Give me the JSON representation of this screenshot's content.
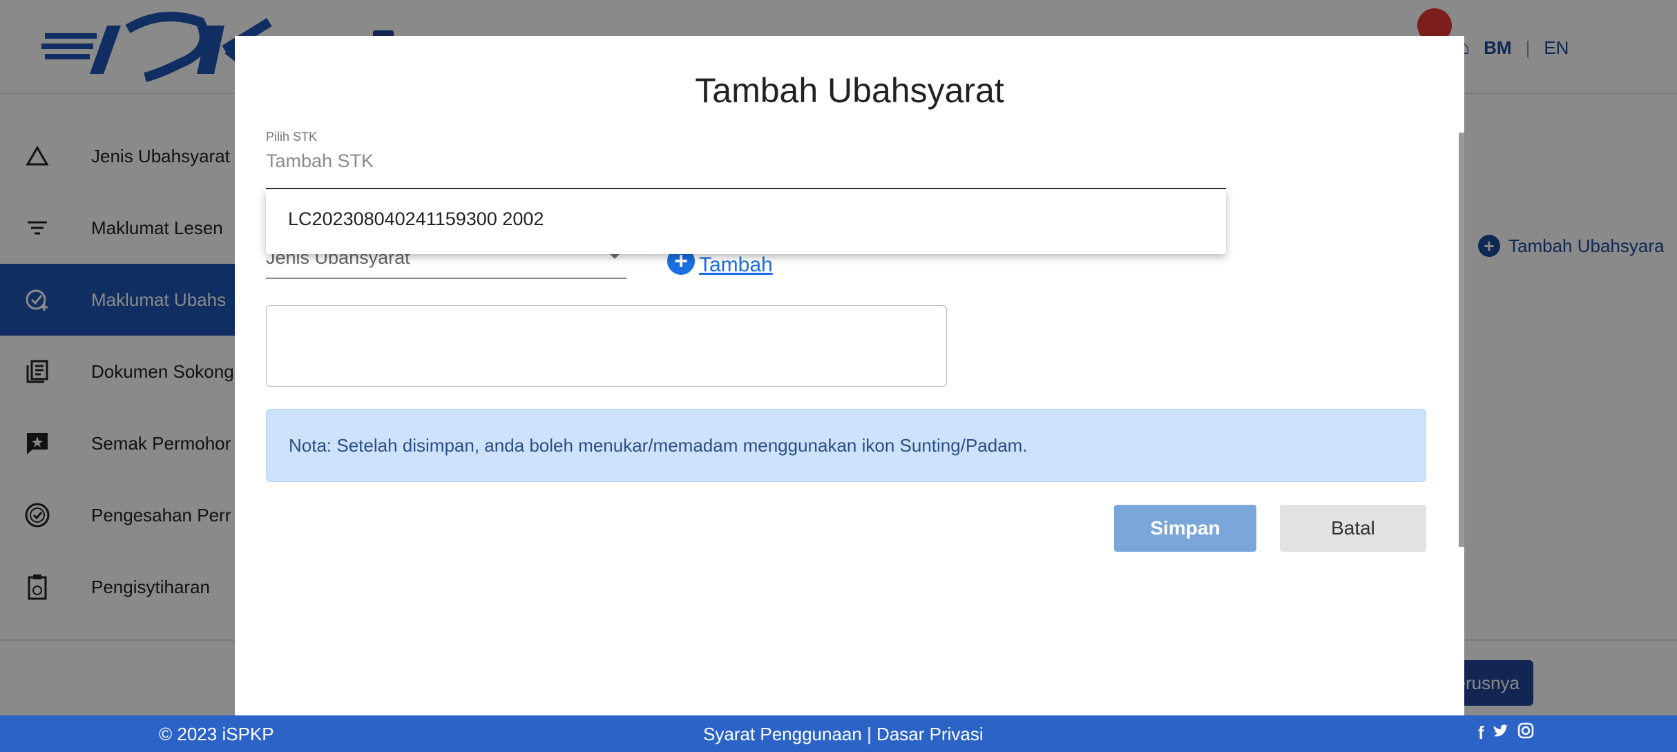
{
  "header": {
    "lang_bm": "BM",
    "lang_sep": "|",
    "lang_en": "EN"
  },
  "sidebar": {
    "items": [
      {
        "label": "Jenis Ubahsyarat",
        "icon": "triangle-icon"
      },
      {
        "label": "Maklumat Lesen",
        "icon": "filter-lines-icon"
      },
      {
        "label": "Maklumat Ubahs",
        "icon": "check-plus-icon",
        "active": true
      },
      {
        "label": "Dokumen Sokong",
        "icon": "document-list-icon"
      },
      {
        "label": "Semak Permohor",
        "icon": "chat-star-icon"
      },
      {
        "label": "Pengesahan Perr",
        "icon": "verified-badge-icon"
      },
      {
        "label": "Pengisytiharan",
        "icon": "clipboard-icon"
      }
    ]
  },
  "background": {
    "add_condition": "Tambah Ubahsyara",
    "next_button": "erusnya"
  },
  "modal": {
    "title": "Tambah Ubahsyarat",
    "stk": {
      "label": "Pilih STK",
      "placeholder": "Tambah STK",
      "option": "LC202308040241159300 2002"
    },
    "condition_type": {
      "placeholder": "Jenis Ubahsyarat"
    },
    "add_label": "Tambah",
    "note": "Nota: Setelah disimpan, anda boleh menukar/memadam menggunakan ikon Sunting/Padam.",
    "save_label": "Simpan",
    "cancel_label": "Batal"
  },
  "footer": {
    "copyright": "© 2023 iSPKP",
    "links": "Syarat Penggunaan | Dasar Privasi",
    "social": [
      "f",
      "🐦",
      "◎"
    ]
  },
  "colors": {
    "primary": "#1f56b3",
    "footer": "#2b63c6",
    "note_bg": "#cfe2fb",
    "save_bg": "#7aa6da"
  }
}
